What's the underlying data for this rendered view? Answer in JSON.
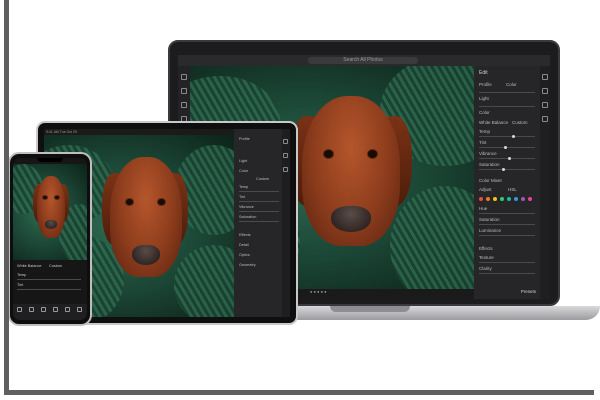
{
  "laptop": {
    "search_placeholder": "Search All Photos",
    "panel": {
      "tab_edit": "Edit",
      "profile_label": "Profile",
      "profile_value": "Color",
      "light_label": "Light",
      "color_label": "Color",
      "white_balance_label": "White Balance",
      "white_balance_value": "Custom",
      "temp_label": "Temp",
      "tint_label": "Tint",
      "vibrance_label": "Vibrance",
      "saturation_label": "Saturation",
      "color_mixer_label": "Color Mixer",
      "adjust_label": "Adjust",
      "adjust_value": "HSL",
      "hue_label": "Hue",
      "sat_label": "Saturation",
      "lum_label": "Luminance",
      "effects_label": "Effects",
      "texture_label": "Texture",
      "clarity_label": "Clarity",
      "presets_label": "Presets",
      "swatches": [
        "#e74c3c",
        "#e67e22",
        "#f1c40f",
        "#2ecc71",
        "#1abc9c",
        "#3498db",
        "#9b59b6",
        "#e84393"
      ]
    }
  },
  "tablet": {
    "status": "9:41 AM  Tue Oct 29",
    "panel": {
      "profile_label": "Profile",
      "light_label": "Light",
      "color_label": "Color",
      "white_balance_value": "Custom",
      "temp_label": "Temp",
      "tint_label": "Tint",
      "vibrance_label": "Vibrance",
      "saturation_label": "Saturation",
      "effects_label": "Effects",
      "detail_label": "Detail",
      "optics_label": "Optics",
      "geometry_label": "Geometry"
    }
  },
  "phone": {
    "white_balance_label": "White Balance",
    "white_balance_value": "Custom",
    "temp_label": "Temp",
    "tint_label": "Tint"
  }
}
